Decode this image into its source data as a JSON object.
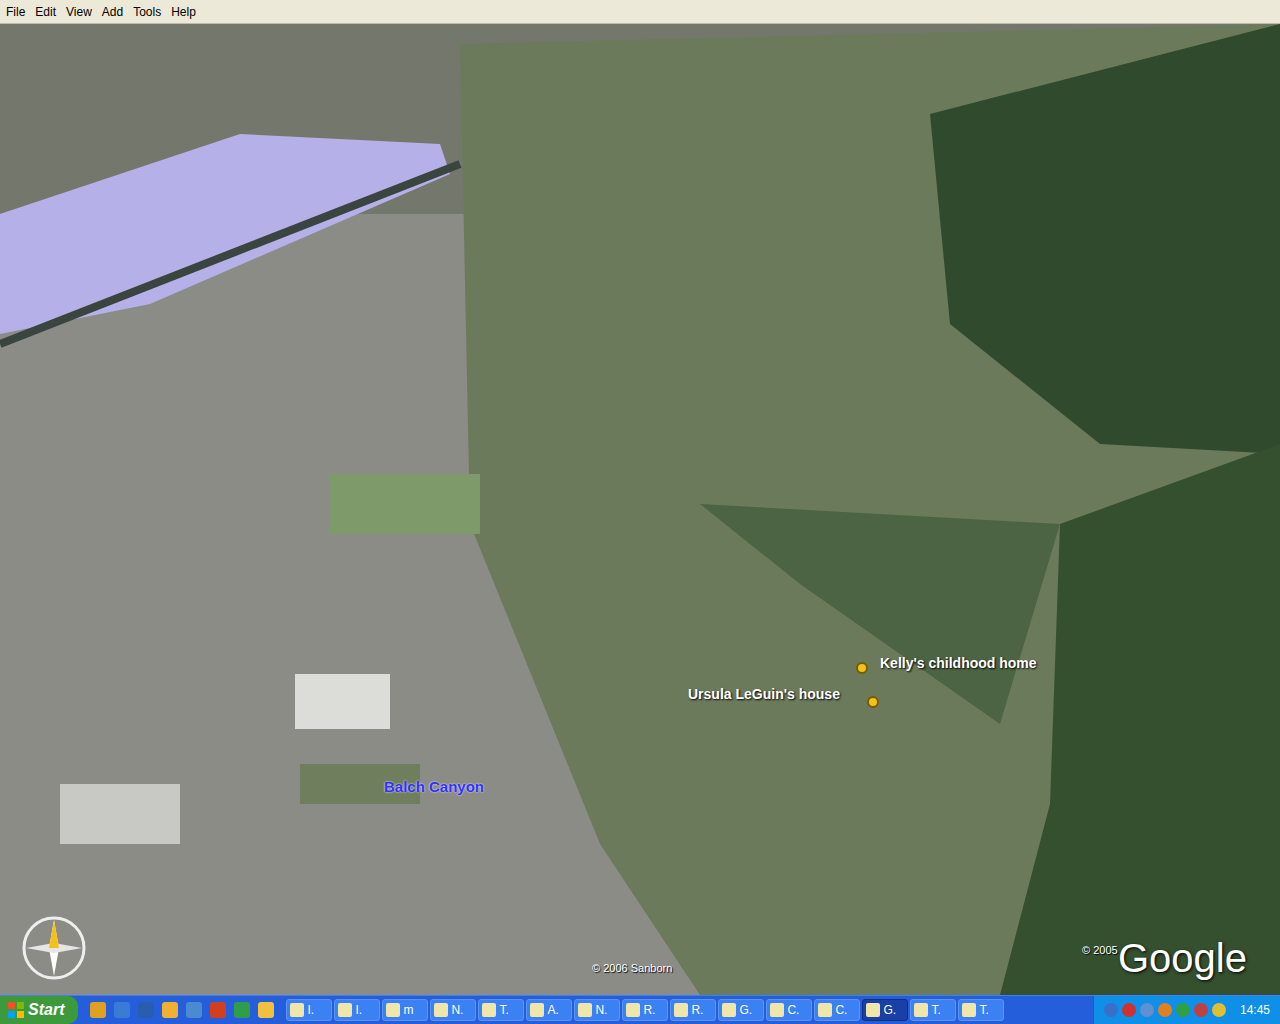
{
  "window": {
    "menu": [
      "File",
      "Edit",
      "View",
      "Add",
      "Tools",
      "Help"
    ]
  },
  "map": {
    "placemarks": [
      {
        "label": "Kelly's childhood home"
      },
      {
        "label": "Ursula LeGuin's house"
      }
    ],
    "places": [
      {
        "label": "Balch Canyon"
      }
    ],
    "attributions": [
      {
        "label": "© 2006 Sanborn"
      },
      {
        "label": "© 2005"
      }
    ],
    "logo": "Google"
  },
  "taskbar": {
    "start": "Start",
    "tasks": [
      {
        "label": "I.",
        "selected": false
      },
      {
        "label": "I.",
        "selected": false
      },
      {
        "label": "m",
        "selected": false
      },
      {
        "label": "N.",
        "selected": false
      },
      {
        "label": "T.",
        "selected": false
      },
      {
        "label": "A.",
        "selected": false
      },
      {
        "label": "N.",
        "selected": false
      },
      {
        "label": "R.",
        "selected": false
      },
      {
        "label": "R.",
        "selected": false
      },
      {
        "label": "G.",
        "selected": false
      },
      {
        "label": "C.",
        "selected": false
      },
      {
        "label": "C.",
        "selected": false
      },
      {
        "label": "G.",
        "selected": true
      },
      {
        "label": "T.",
        "selected": false
      },
      {
        "label": "T.",
        "selected": false
      }
    ],
    "clock": "14:45"
  }
}
